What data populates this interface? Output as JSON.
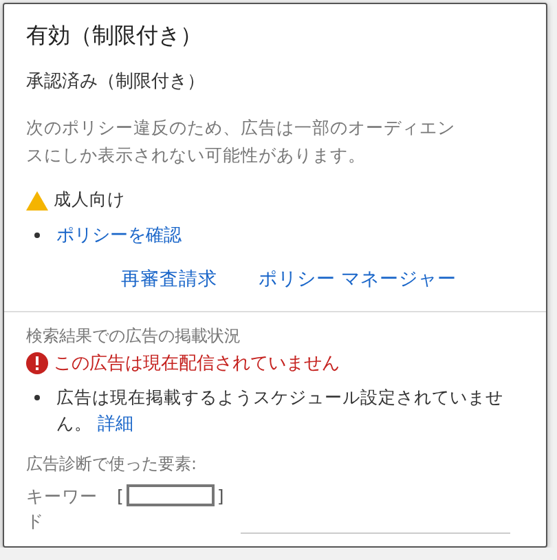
{
  "title": "有効（制限付き）",
  "status": "承認済み（制限付き）",
  "description": "次のポリシー違反のため、広告は一部のオーディエンスにしか表示されない可能性があります。",
  "violations": [
    {
      "kind": "warning",
      "label": "成人向け"
    }
  ],
  "policy_link": "ポリシーを確認",
  "actions": [
    "再審査請求",
    "ポリシー マネージャー"
  ],
  "search_section": {
    "heading": "検索結果での広告の掲載状況",
    "error": "この広告は現在配信されていません",
    "reason": "広告は現在掲載するようスケジュール設定されていません。",
    "reason_link": "詳細"
  },
  "diagnosis": {
    "heading": "広告診断で使った要素:",
    "fields": [
      {
        "label": "キーワード",
        "open": "[",
        "close": "]",
        "redacted": true
      }
    ]
  }
}
